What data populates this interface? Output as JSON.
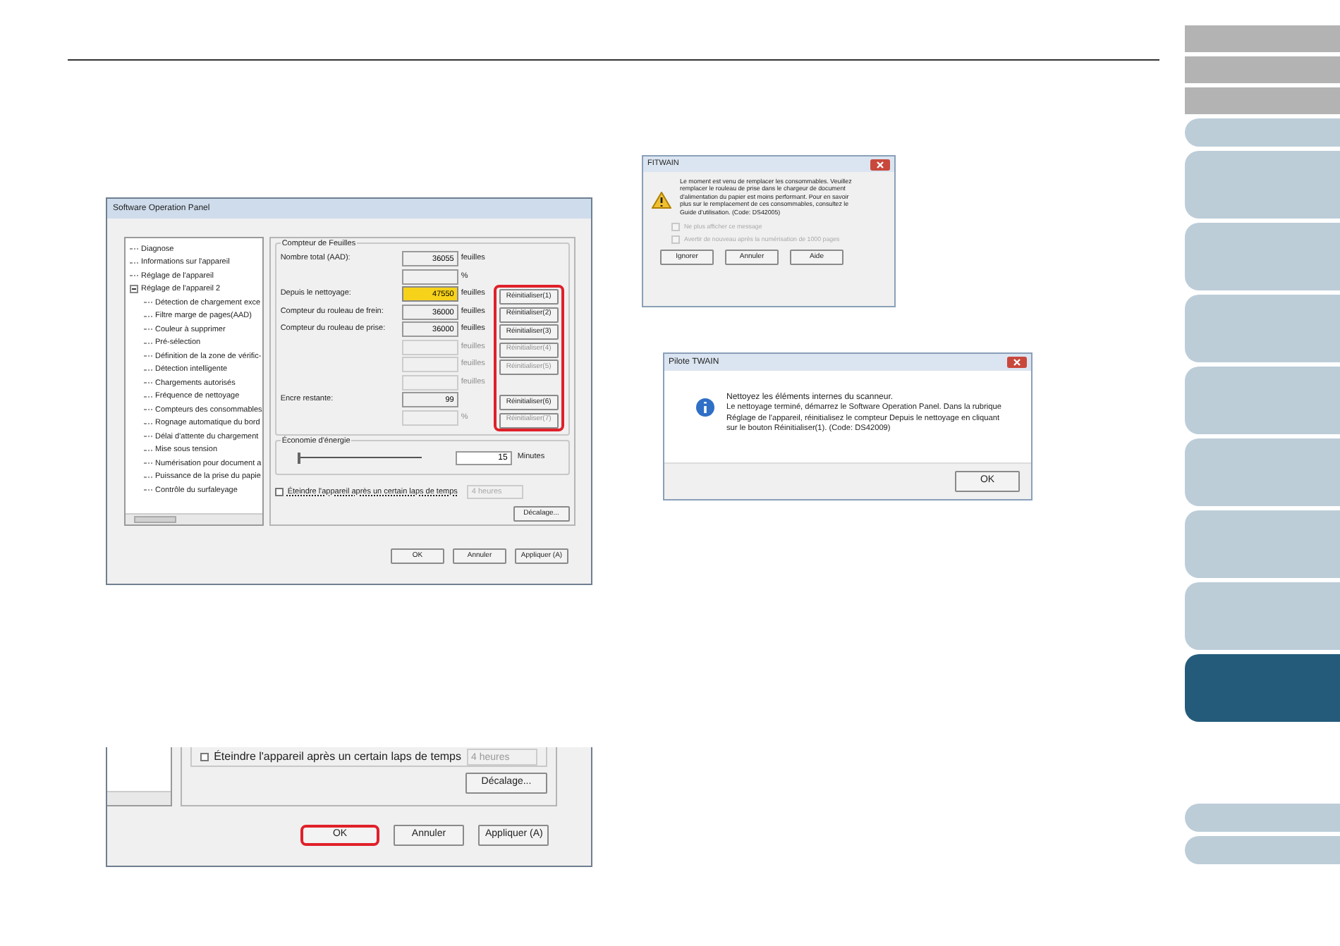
{
  "nav_tabs": [
    {
      "kind": "square",
      "selected": false
    },
    {
      "kind": "square",
      "selected": false
    },
    {
      "kind": "square",
      "selected": false
    },
    {
      "kind": "short",
      "selected": false
    },
    {
      "kind": "tall",
      "selected": false
    },
    {
      "kind": "tall",
      "selected": false
    },
    {
      "kind": "tall",
      "selected": false
    },
    {
      "kind": "tall",
      "selected": false
    },
    {
      "kind": "tall",
      "selected": false
    },
    {
      "kind": "tall",
      "selected": false
    },
    {
      "kind": "tall",
      "selected": false
    },
    {
      "kind": "tall",
      "selected": true
    },
    {
      "kind": "gap"
    },
    {
      "kind": "short",
      "selected": false
    },
    {
      "kind": "short",
      "selected": false
    }
  ],
  "panel": {
    "title": "Software Operation Panel",
    "tree": [
      {
        "label": "Diagnose"
      },
      {
        "label": "Informations sur l'appareil"
      },
      {
        "label": "Réglage de l'appareil"
      },
      {
        "label": "Réglage de l'appareil 2",
        "expanded": true,
        "children": [
          {
            "label": "Détection de chargement exce"
          },
          {
            "label": "Filtre marge de pages(AAD)"
          },
          {
            "label": "Couleur à supprimer"
          },
          {
            "label": "Pré-sélection"
          },
          {
            "label": "Définition de la zone de vérific-"
          },
          {
            "label": "Détection intelligente"
          },
          {
            "label": "Chargements autorisés"
          },
          {
            "label": "Fréquence de nettoyage"
          },
          {
            "label": "Compteurs des consommables"
          },
          {
            "label": "Rognage automatique du bord"
          },
          {
            "label": "Délai d'attente du chargement"
          },
          {
            "label": "Mise sous tension"
          },
          {
            "label": "Numérisation pour document a"
          },
          {
            "label": "Puissance de la prise du papie"
          },
          {
            "label": "Contrôle du surfaleyage"
          }
        ]
      }
    ],
    "counter_group": {
      "title": "Compteur de Feuilles",
      "rows": [
        {
          "label": "Nombre total (AAD):",
          "value": "36055",
          "unit": "feuilles",
          "highlighted": false,
          "disabled": false
        },
        {
          "label": "",
          "value": "",
          "unit": "%",
          "highlighted": false,
          "disabled": false
        },
        {
          "label": "Depuis le nettoyage:",
          "value": "47550",
          "unit": "feuilles",
          "highlighted": true,
          "disabled": false,
          "reset": {
            "label": "Réinitialiser(1)",
            "disabled": false
          }
        },
        {
          "label": "Compteur du rouleau de frein:",
          "value": "36000",
          "unit": "feuilles",
          "highlighted": false,
          "disabled": false,
          "reset": {
            "label": "Réinitialiser(2)",
            "disabled": false
          }
        },
        {
          "label": "Compteur du rouleau de prise:",
          "value": "36000",
          "unit": "feuilles",
          "highlighted": false,
          "disabled": false,
          "reset": {
            "label": "Réinitialiser(3)",
            "disabled": false
          }
        },
        {
          "label": "",
          "value": "",
          "unit": "feuilles",
          "highlighted": false,
          "disabled": true,
          "reset": {
            "label": "Réinitialiser(4)",
            "disabled": true
          }
        },
        {
          "label": "",
          "value": "",
          "unit": "feuilles",
          "highlighted": false,
          "disabled": true,
          "reset": {
            "label": "Réinitialiser(5)",
            "disabled": true
          }
        },
        {
          "label": "",
          "value": "",
          "unit": "feuilles",
          "highlighted": false,
          "disabled": true
        },
        {
          "label": "Encre restante:",
          "value": "99",
          "unit": "",
          "highlighted": false,
          "disabled": false,
          "reset": {
            "label": "Réinitialiser(6)",
            "disabled": false
          }
        },
        {
          "label": "",
          "value": "",
          "unit": "%",
          "highlighted": false,
          "disabled": true,
          "reset": {
            "label": "Réinitialiser(7)",
            "disabled": true
          }
        }
      ],
      "callout": true
    },
    "energy": {
      "title": "Économie d'énergie",
      "level": 0.0,
      "value": "15",
      "unit": "Minutes"
    },
    "shutdown": {
      "label": "Éteindre l'appareil après un certain laps de temps",
      "checked": false,
      "select": "4 heures",
      "select_disabled": true
    },
    "offset_button": "Décalage...",
    "footer": [
      {
        "label": "OK",
        "callout": false
      },
      {
        "label": "Annuler",
        "callout": false
      },
      {
        "label": "Appliquer (A)",
        "callout": false
      }
    ]
  },
  "panel_detail": {
    "shutdown": {
      "label": "Éteindre l'appareil après un certain laps de temps",
      "checked": false,
      "select": "4 heures"
    },
    "offset_button": "Décalage...",
    "footer": [
      {
        "label": "OK",
        "callout": true
      },
      {
        "label": "Annuler",
        "callout": false
      },
      {
        "label": "Appliquer (A)",
        "callout": false
      }
    ]
  },
  "fitwain_dialog": {
    "title": "FITWAIN",
    "message": "Le moment est venu de remplacer les consommables. Veuillez remplacer le rouleau de prise dans le chargeur de document d'alimentation du papier est moins performant. Pour en savoir plus sur le remplacement de ces consommables, consultez le Guide d'utilisation. (Code: DS42005)",
    "options": [
      {
        "label": "Ne plus afficher ce message",
        "checked": false,
        "disabled": true
      },
      {
        "label": "Avertir de nouveau après la numérisation de 1000 pages",
        "checked": false,
        "disabled": true
      }
    ],
    "buttons": [
      "Ignorer",
      "Annuler",
      "Aide"
    ]
  },
  "twain_dialog": {
    "title": "Pilote TWAIN",
    "heading": "Nettoyez les éléments internes du scanneur.",
    "message": "Le nettoyage terminé, démarrez le Software Operation Panel. Dans la rubrique Réglage de l'appareil, réinitialisez le compteur Depuis le nettoyage en cliquant sur le bouton Réinitialiser(1). (Code: DS42009)",
    "buttons": [
      "OK"
    ]
  }
}
